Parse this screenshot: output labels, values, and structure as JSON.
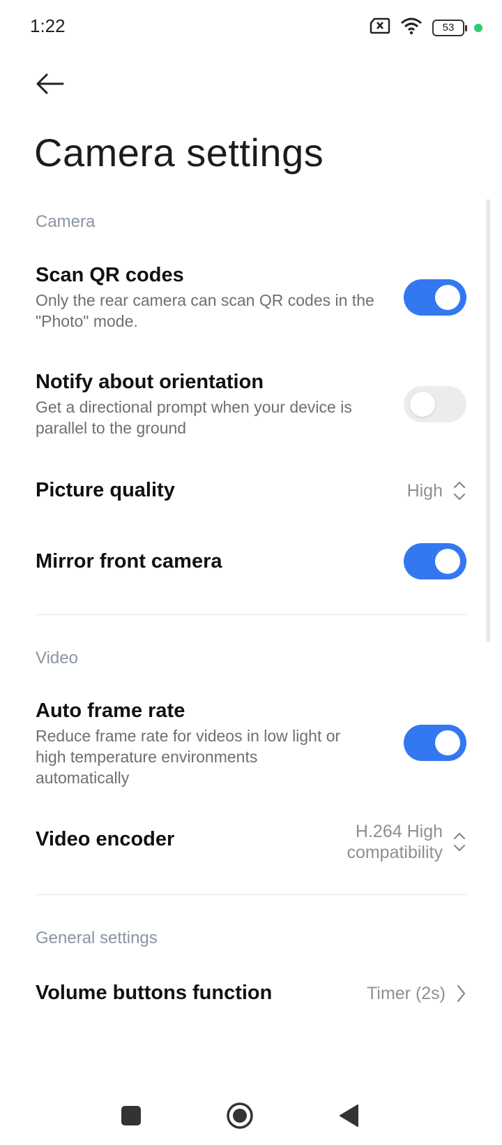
{
  "status_bar": {
    "time": "1:22",
    "battery": "53",
    "icons": [
      "sim-off-icon",
      "wifi-icon",
      "battery-icon",
      "charging-dot-icon"
    ]
  },
  "header": {
    "back_icon": "arrow-left-icon",
    "title": "Camera settings"
  },
  "sections": {
    "camera": {
      "header": "Camera",
      "scan_qr": {
        "title": "Scan QR codes",
        "desc": "Only the rear camera can scan QR codes in the \"Photo\" mode.",
        "enabled": true
      },
      "orientation": {
        "title": "Notify about orientation",
        "desc": "Get a directional prompt when your device is parallel to the ground",
        "enabled": false
      },
      "picture_quality": {
        "title": "Picture quality",
        "value": "High",
        "icon": "chevron-up-down-icon"
      },
      "mirror": {
        "title": "Mirror front camera",
        "enabled": true
      }
    },
    "video": {
      "header": "Video",
      "auto_frame": {
        "title": "Auto frame rate",
        "desc": "Reduce frame rate for videos in low light or high temperature environments automatically",
        "enabled": true
      },
      "encoder": {
        "title": "Video encoder",
        "value_line1": "H.264 High",
        "value_line2": "compatibility",
        "icon": "chevron-up-down-icon"
      }
    },
    "general": {
      "header": "General settings",
      "volume": {
        "title": "Volume buttons function",
        "value": "Timer (2s)",
        "icon": "chevron-right-icon"
      }
    }
  },
  "colors": {
    "accent": "#3378f0",
    "toggle_off": "#ececec",
    "section_header": "#8a93a3"
  },
  "nav_bar": {
    "items": [
      "recents-square-icon",
      "home-circle-icon",
      "back-triangle-icon"
    ]
  }
}
